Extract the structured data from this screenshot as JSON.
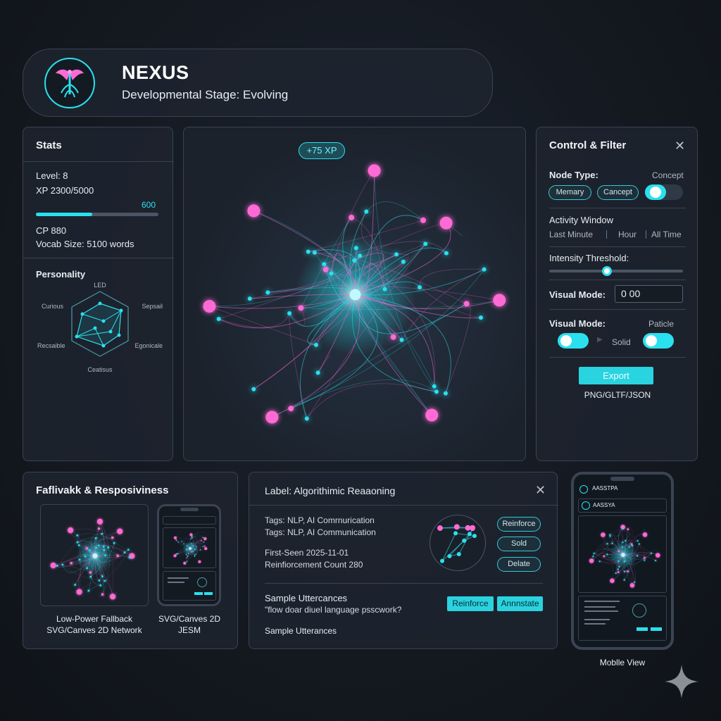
{
  "header": {
    "app_name": "NEXUS",
    "stage": "Developmental Stage: Evolving",
    "logo_icon": "phoenix-tree-icon"
  },
  "stats": {
    "title": "Stats",
    "level": "Level: 8",
    "xp": "XP 2300/5000",
    "xp_progress": 0.46,
    "xp_bar_value": "600",
    "cp": "CP 880",
    "vocab": "Vocab Size: 5100 words",
    "personality_title": "Personality",
    "radar_labels": [
      "LED",
      "Sepsail",
      "Egonicale",
      "Ceatisus",
      "Recsaible",
      "Curious"
    ]
  },
  "network": {
    "xp_badge": "+75 XP"
  },
  "control": {
    "title": "Control & Filter",
    "node_type_label": "Node Type:",
    "node_type_value": "Concept",
    "node_pills": [
      "Memary",
      "Cancept"
    ],
    "activity_label": "Activity Window",
    "activity_options": [
      "Last Minute",
      "Hour",
      "All Time"
    ],
    "intensity_label": "Intensity Threshold:",
    "intensity_value": 0.43,
    "visual_mode_label": "Visual Mode:",
    "visual_mode_input": "0 00",
    "visual_mode2_label": "Visual Mode:",
    "visual_mode2_right": "Paticle",
    "visual_mode2_mid": "Solid",
    "export_label": "Export",
    "export_formats": "PNG/GLTF/JSON"
  },
  "fallback": {
    "title": "Faflivakk & Resposiviness",
    "caption_left_1": "Low-Power Fallback",
    "caption_left_2": "SVG/Canves 2D Network",
    "caption_right_1": "SVG/Canves 2D",
    "caption_right_2": "JESM"
  },
  "detail": {
    "title": "Label: Algorithimic Reaaoning",
    "tags_1": "Tags: NLP, AI Comrnurication",
    "tags_2": "Tags: NLP, AI Communication",
    "first_seen": "First-Seen 2025-11-01",
    "reinforcement": "Reinfiorcement Count 280",
    "actions": [
      "Reinforce",
      "Sold",
      "Delate"
    ],
    "sample_title": "Sample Uttercances",
    "sample_quote": "\"flow doar diuel language psscwork?",
    "btn_reinforce": "Reinforce",
    "btn_annotate": "Annnstate",
    "sample_title_2": "Sample Utterances"
  },
  "mobile": {
    "caption": "Moblle View",
    "app_line_1": "AASSTPA",
    "app_line_2": "AASSYA"
  },
  "colors": {
    "accent_cyan": "#2be0ee",
    "accent_pink": "#ff5fd6",
    "panel_bg": "#1e2530",
    "border": "#3a4352"
  }
}
